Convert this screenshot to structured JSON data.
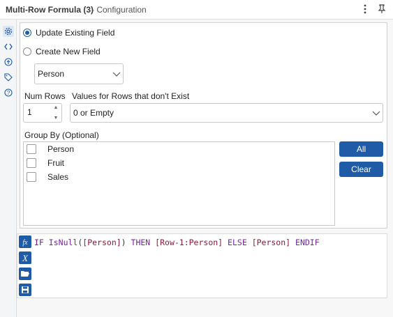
{
  "window": {
    "title": "Multi-Row Formula (3)",
    "subtitle": "- Configuration"
  },
  "sidebar": {
    "icons": [
      "gear-icon",
      "code-icon",
      "arrow-circle-icon",
      "tag-icon",
      "help-icon"
    ]
  },
  "options": {
    "update_label": "Update Existing Field",
    "create_label": "Create New  Field",
    "selected": "update",
    "field_value": "Person"
  },
  "num_rows": {
    "label": "Num Rows",
    "value": "1"
  },
  "nonexist": {
    "label": "Values for Rows that don't Exist",
    "value": "0 or Empty"
  },
  "group_by": {
    "label": "Group By (Optional)",
    "items": [
      {
        "label": "Person",
        "checked": false
      },
      {
        "label": "Fruit",
        "checked": false
      },
      {
        "label": "Sales",
        "checked": false
      }
    ],
    "all_label": "All",
    "clear_label": "Clear"
  },
  "expression": {
    "t1": "IF",
    "t2": " ",
    "t3": "IsNull",
    "t4": "(",
    "t5": "[Person]",
    "t6": ") ",
    "t7": "THEN",
    "t8": " ",
    "t9": "[Row-1:Person]",
    "t10": " ",
    "t11": "ELSE",
    "t12": " ",
    "t13": "[Person]",
    "t14": " ",
    "t15": "ENDIF",
    "icons": [
      "fx-icon",
      "variable-x-icon",
      "folder-open-icon",
      "save-icon"
    ]
  },
  "colors": {
    "accent": "#1f5ba7",
    "keyword": "#7b1fa2",
    "field": "#8b1a3a"
  }
}
